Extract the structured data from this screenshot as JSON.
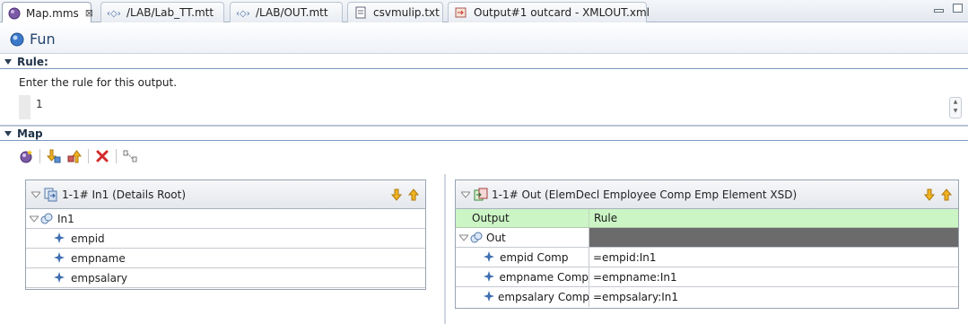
{
  "tabs": [
    {
      "label": "Map.mms",
      "icon": "map-icon",
      "active": true,
      "closable": true
    },
    {
      "label": "/LAB/Lab_TT.mtt",
      "icon": "xml-file-icon"
    },
    {
      "label": "/LAB/OUT.mtt",
      "icon": "xml-file-icon"
    },
    {
      "label": "csvmulip.txt",
      "icon": "text-file-icon"
    },
    {
      "label": "Output#1 outcard - XMLOUT.xml",
      "icon": "output-card-icon"
    }
  ],
  "editor": {
    "title": "Fun",
    "icon": "function-icon"
  },
  "rule_section": {
    "header": "Rule:",
    "description": "Enter the rule for this output.",
    "line_number": "1",
    "rule_text": ""
  },
  "map_section": {
    "header": "Map"
  },
  "toolbar": {
    "items": [
      "new-map-icon",
      "move-down-icon",
      "move-up-icon",
      "delete-icon",
      "link-icon"
    ]
  },
  "input_panel": {
    "title": "1-1# In1 (Details Root)",
    "root": "In1",
    "fields": [
      "empid",
      "empname",
      "empsalary"
    ]
  },
  "output_panel": {
    "title": "1-1# Out (ElemDecl Employee Comp Emp Element XSD)",
    "columns": {
      "output": "Output",
      "rule": "Rule"
    },
    "root": "Out",
    "rows": [
      {
        "name": "empid Comp",
        "rule": "=empid:In1"
      },
      {
        "name": "empname Comp",
        "rule": "=empname:In1"
      },
      {
        "name": "empsalary Comp",
        "rule": "=empsalary:In1"
      }
    ]
  },
  "colors": {
    "header_green": "#ccf5c5",
    "accent": "#27456e",
    "rule_bg_dark": "#6b6b6b"
  }
}
